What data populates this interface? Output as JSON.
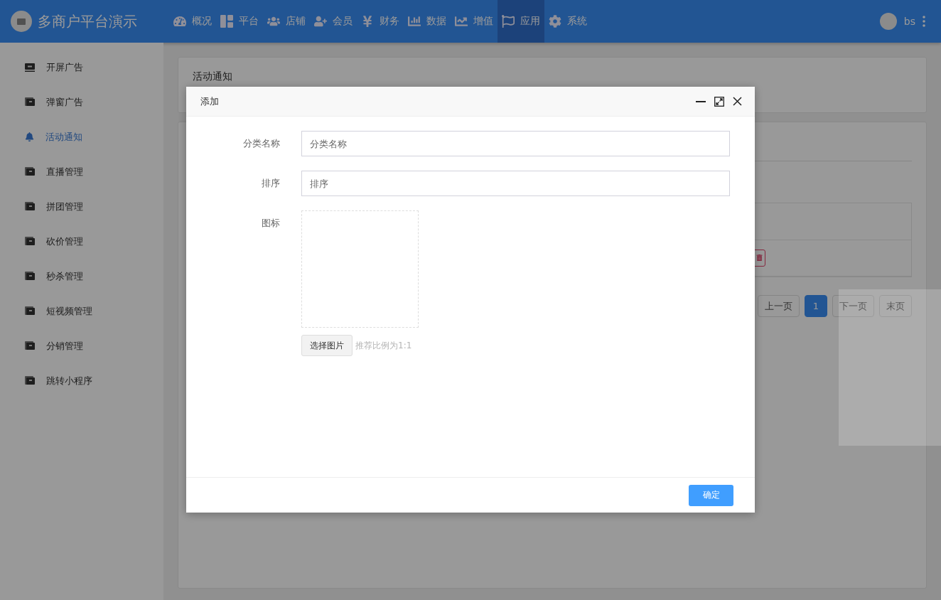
{
  "header": {
    "title": "多商户平台演示",
    "nav": [
      {
        "label": "概况",
        "selected": false
      },
      {
        "label": "平台",
        "selected": false
      },
      {
        "label": "店铺",
        "selected": false
      },
      {
        "label": "会员",
        "selected": false
      },
      {
        "label": "财务",
        "selected": false
      },
      {
        "label": "数据",
        "selected": false
      },
      {
        "label": "增值",
        "selected": false
      },
      {
        "label": "应用",
        "selected": true
      },
      {
        "label": "系统",
        "selected": false
      }
    ],
    "user": "bs"
  },
  "sidebar": {
    "items": [
      {
        "label": "开屏广告",
        "selected": false
      },
      {
        "label": "弹窗广告",
        "selected": false
      },
      {
        "label": "活动通知",
        "selected": true
      },
      {
        "label": "直播管理",
        "selected": false
      },
      {
        "label": "拼团管理",
        "selected": false
      },
      {
        "label": "砍价管理",
        "selected": false
      },
      {
        "label": "秒杀管理",
        "selected": false
      },
      {
        "label": "短视频管理",
        "selected": false
      },
      {
        "label": "分销管理",
        "selected": false
      },
      {
        "label": "跳转小程序",
        "selected": false
      }
    ]
  },
  "page": {
    "title": "活动通知",
    "pagination": [
      {
        "label": "上一页",
        "selected": false
      },
      {
        "label": "1",
        "selected": true
      },
      {
        "label": "下一页",
        "selected": false
      },
      {
        "label": "末页",
        "selected": false
      }
    ]
  },
  "dialog": {
    "title": "添加",
    "fields": [
      {
        "label": "分类名称",
        "placeholder": "分类名称"
      },
      {
        "label": "排序",
        "placeholder": "排序"
      }
    ],
    "upload": {
      "label": "图标",
      "button": "选择图片",
      "hint": "推荐比例为1:1"
    },
    "confirm": "确定"
  }
}
